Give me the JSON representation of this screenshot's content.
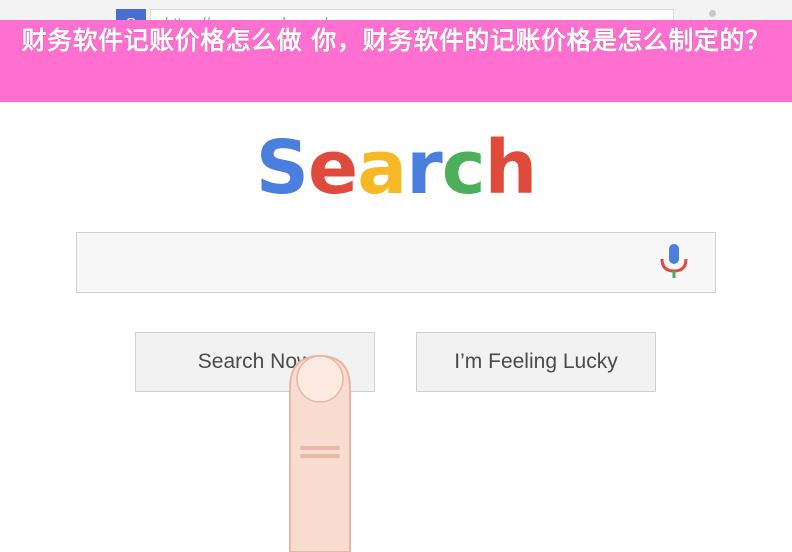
{
  "browser": {
    "back_glyph": "←",
    "forward_glyph": "→",
    "favicon_letter": "S",
    "url": "https://www.search.com/"
  },
  "banner": {
    "title": "财务软件记账价格怎么做 你，财务软件的记账价格是怎么制定的？",
    "color": "#ff6fcf"
  },
  "logo": {
    "letters": [
      {
        "char": "S",
        "color": "#4a7fe0"
      },
      {
        "char": "e",
        "color": "#e04a3c"
      },
      {
        "char": "a",
        "color": "#f6b825"
      },
      {
        "char": "r",
        "color": "#4a7fe0"
      },
      {
        "char": "c",
        "color": "#4caf5a"
      },
      {
        "char": "h",
        "color": "#e04a3c"
      }
    ]
  },
  "search": {
    "value": ""
  },
  "buttons": {
    "search_now": "Search Now",
    "lucky": "I’m Feeling Lucky"
  },
  "icons": {
    "mic": "microphone-icon",
    "pointer": "finger-pointer-icon",
    "menu": "menu-dots-icon"
  }
}
